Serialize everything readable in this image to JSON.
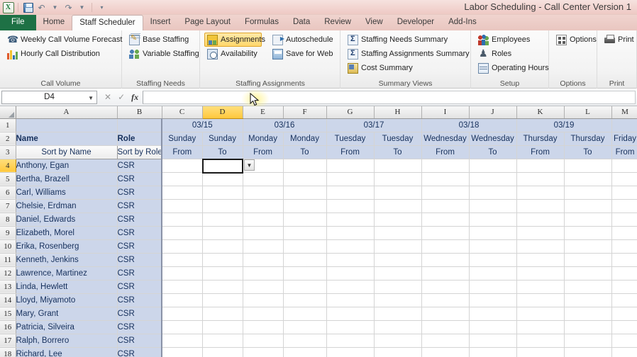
{
  "window": {
    "title": "Labor Scheduling - Call Center Version 1",
    "quick_access": [
      "excel-logo",
      "save-icon",
      "undo-icon",
      "redo-icon",
      "customize-qat-icon"
    ]
  },
  "ribbon": {
    "tabs": [
      {
        "label": "File",
        "type": "file"
      },
      {
        "label": "Home",
        "type": "normal"
      },
      {
        "label": "Staff Scheduler",
        "type": "active"
      },
      {
        "label": "Insert",
        "type": "normal"
      },
      {
        "label": "Page Layout",
        "type": "normal"
      },
      {
        "label": "Formulas",
        "type": "normal"
      },
      {
        "label": "Data",
        "type": "normal"
      },
      {
        "label": "Review",
        "type": "normal"
      },
      {
        "label": "View",
        "type": "normal"
      },
      {
        "label": "Developer",
        "type": "normal"
      },
      {
        "label": "Add-Ins",
        "type": "normal"
      }
    ],
    "groups": [
      {
        "title": "Call Volume",
        "items": [
          {
            "label": "Weekly Call Volume Forecast",
            "icon": "phone-icon",
            "selected": false
          },
          {
            "label": "Hourly Call Distribution",
            "icon": "bar-chart-icon",
            "selected": false
          }
        ]
      },
      {
        "title": "Staffing Needs",
        "items": [
          {
            "label": "Base Staffing",
            "icon": "sheet-pencil-icon",
            "selected": false
          },
          {
            "label": "Variable Staffing",
            "icon": "people-icon",
            "selected": false
          }
        ]
      },
      {
        "title": "Staffing Assignments",
        "items": [
          {
            "label": "Assignments",
            "icon": "assignments-icon",
            "selected": true
          },
          {
            "label": "Availability",
            "icon": "clock-icon",
            "selected": false
          }
        ]
      },
      {
        "title": "",
        "items": [
          {
            "label": "Autoschedule",
            "icon": "autoschedule-icon",
            "selected": false
          },
          {
            "label": "Save for Web",
            "icon": "web-icon",
            "selected": false
          }
        ]
      },
      {
        "title": "Summary Views",
        "items": [
          {
            "label": "Staffing Needs Summary",
            "icon": "sigma-icon",
            "selected": false
          },
          {
            "label": "Staffing Assignments Summary",
            "icon": "sigma-icon",
            "selected": false
          },
          {
            "label": "Cost Summary",
            "icon": "cost-icon",
            "selected": false
          }
        ]
      },
      {
        "title": "Setup",
        "items": [
          {
            "label": "Employees",
            "icon": "employees-icon",
            "selected": false
          },
          {
            "label": "Roles",
            "icon": "roles-icon",
            "selected": false
          },
          {
            "label": "Operating Hours",
            "icon": "operating-hours-icon",
            "selected": false
          }
        ]
      },
      {
        "title": "Options",
        "items": [
          {
            "label": "Options",
            "icon": "options-icon",
            "selected": false
          }
        ]
      },
      {
        "title": "Print",
        "items": [
          {
            "label": "Print",
            "icon": "print-icon",
            "selected": false
          }
        ]
      }
    ]
  },
  "formula_bar": {
    "name_box_value": "D4",
    "formula_value": "",
    "cancel_icon": "cancel-icon",
    "enter_icon": "enter-icon",
    "function_icon": "fx-icon"
  },
  "grid": {
    "column_headers": [
      "A",
      "B",
      "C",
      "D",
      "E",
      "F",
      "G",
      "H",
      "I",
      "J",
      "K",
      "L",
      "M"
    ],
    "selected_column": "D",
    "selected_row": 4,
    "selected_cell": "D4",
    "row_numbers": [
      1,
      2,
      3,
      4,
      5,
      6,
      7,
      8,
      9,
      10,
      11,
      12,
      13,
      14,
      15,
      16,
      17,
      18
    ],
    "header_rows": {
      "dates": [
        {
          "date": "03/15",
          "columns": [
            "C",
            "D"
          ]
        },
        {
          "date": "03/16",
          "columns": [
            "E",
            "F"
          ]
        },
        {
          "date": "03/17",
          "columns": [
            "G",
            "H"
          ]
        },
        {
          "date": "03/18",
          "columns": [
            "I",
            "J"
          ]
        },
        {
          "date": "03/19",
          "columns": [
            "K",
            "L"
          ]
        }
      ],
      "days": [
        "Sunday",
        "Sunday",
        "Monday",
        "Monday",
        "Tuesday",
        "Tuesday",
        "Wednesday",
        "Wednesday",
        "Thursday",
        "Thursday",
        "Friday"
      ],
      "fromto": [
        "From",
        "To",
        "From",
        "To",
        "From",
        "To",
        "From",
        "To",
        "From",
        "To",
        "From"
      ]
    },
    "labels": {
      "name": "Name",
      "role": "Role",
      "sort_by_name": "Sort by Name",
      "sort_by_role": "Sort by Role"
    },
    "employees": [
      {
        "row": 4,
        "name": "Anthony, Egan",
        "role": "CSR"
      },
      {
        "row": 5,
        "name": "Bertha, Brazell",
        "role": "CSR"
      },
      {
        "row": 6,
        "name": "Carl, Williams",
        "role": "CSR"
      },
      {
        "row": 7,
        "name": "Chelsie, Erdman",
        "role": "CSR"
      },
      {
        "row": 8,
        "name": "Daniel, Edwards",
        "role": "CSR"
      },
      {
        "row": 9,
        "name": "Elizabeth, Morel",
        "role": "CSR"
      },
      {
        "row": 10,
        "name": "Erika, Rosenberg",
        "role": "CSR"
      },
      {
        "row": 11,
        "name": "Kenneth, Jenkins",
        "role": "CSR"
      },
      {
        "row": 12,
        "name": "Lawrence, Martinez",
        "role": "CSR"
      },
      {
        "row": 13,
        "name": "Linda, Hewlett",
        "role": "CSR"
      },
      {
        "row": 14,
        "name": "Lloyd, Miyamoto",
        "role": "CSR"
      },
      {
        "row": 15,
        "name": "Mary, Grant",
        "role": "CSR"
      },
      {
        "row": 16,
        "name": "Patricia, Silveira",
        "role": "CSR"
      },
      {
        "row": 17,
        "name": "Ralph, Borrero",
        "role": "CSR"
      },
      {
        "row": 18,
        "name": "Richard, Lee",
        "role": "CSR"
      }
    ],
    "data_validation_dropdown_icon": "chevron-down-icon"
  },
  "colors": {
    "accent_green": "#1e7145",
    "title_bar": "#f0d4cf",
    "selection_yellow": "#ffc83c",
    "header_blue": "#ccd6ea",
    "text_blue": "#16305c"
  }
}
